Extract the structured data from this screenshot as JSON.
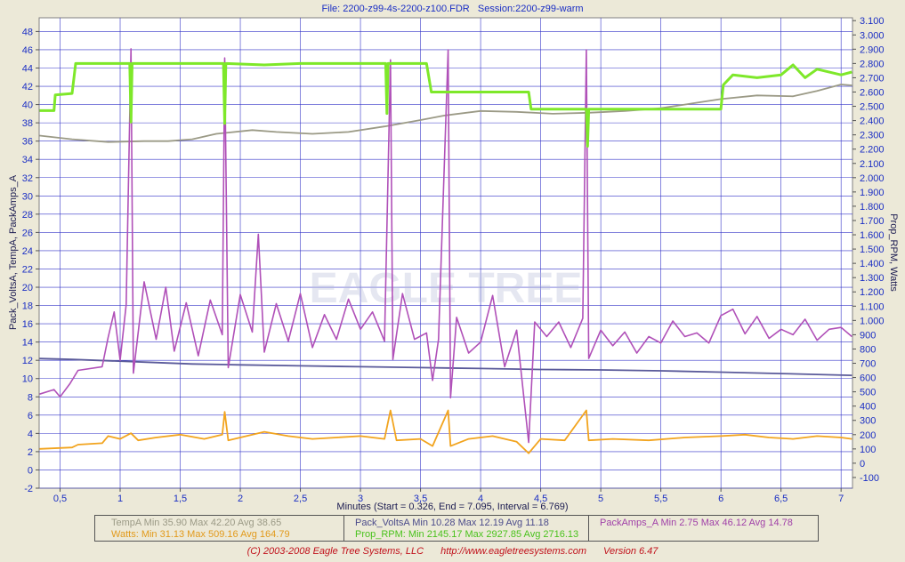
{
  "header": {
    "file": "File: 2200-z99-4s-2200-z100.FDR",
    "session": "Session:2200-z99-warm"
  },
  "chart_data": {
    "type": "line",
    "xlabel": "Minutes (Start = 0.326, End = 7.095, Interval = 6.769)",
    "ylabel_left": "Pack_VoltsA, TempA, PackAmps_A",
    "ylabel_right": "Prop_RPM, Watts",
    "xlim": [
      0.326,
      7.095
    ],
    "ylim_left": [
      -2,
      49.5
    ],
    "ylim_right": [
      -175,
      3120
    ],
    "x_ticks": [
      "0,5",
      "1",
      "1,5",
      "2",
      "2,5",
      "3",
      "3,5",
      "4",
      "4,5",
      "5",
      "5,5",
      "6",
      "6,5",
      "7"
    ],
    "y_ticks_left": [
      "-2",
      "0",
      "2",
      "4",
      "6",
      "8",
      "10",
      "12",
      "14",
      "16",
      "18",
      "20",
      "22",
      "24",
      "26",
      "28",
      "30",
      "32",
      "34",
      "36",
      "38",
      "40",
      "42",
      "44",
      "46",
      "48"
    ],
    "y_ticks_right": [
      "-100",
      "0",
      "100",
      "200",
      "300",
      "400",
      "500",
      "600",
      "700",
      "800",
      "900",
      "1.000",
      "1.100",
      "1.200",
      "1.300",
      "1.400",
      "1.500",
      "1.600",
      "1.700",
      "1.800",
      "1.900",
      "2.000",
      "2.100",
      "2.200",
      "2.300",
      "2.400",
      "2.500",
      "2.600",
      "2.700",
      "2.800",
      "2.900",
      "3.000",
      "3.100"
    ],
    "grid": true,
    "watermark": "EAGLE TREE",
    "series": [
      {
        "name": "TempA",
        "axis": "left",
        "color": "#9b9a86",
        "points": [
          [
            0.33,
            36.6
          ],
          [
            0.6,
            36.2
          ],
          [
            0.9,
            35.9
          ],
          [
            1.2,
            36.0
          ],
          [
            1.4,
            36.0
          ],
          [
            1.6,
            36.2
          ],
          [
            1.8,
            36.8
          ],
          [
            2.1,
            37.2
          ],
          [
            2.3,
            37.0
          ],
          [
            2.6,
            36.8
          ],
          [
            2.9,
            37.0
          ],
          [
            3.2,
            37.6
          ],
          [
            3.5,
            38.3
          ],
          [
            3.7,
            38.8
          ],
          [
            4.0,
            39.3
          ],
          [
            4.3,
            39.2
          ],
          [
            4.6,
            39.0
          ],
          [
            4.9,
            39.1
          ],
          [
            5.2,
            39.3
          ],
          [
            5.5,
            39.6
          ],
          [
            5.8,
            40.2
          ],
          [
            6.0,
            40.6
          ],
          [
            6.3,
            41.0
          ],
          [
            6.6,
            40.9
          ],
          [
            6.8,
            41.5
          ],
          [
            7.0,
            42.2
          ],
          [
            7.09,
            42.1
          ]
        ]
      },
      {
        "name": "Pack_VoltsA",
        "axis": "left",
        "color": "#5a5a9a",
        "points": [
          [
            0.33,
            12.19
          ],
          [
            0.6,
            12.1
          ],
          [
            0.9,
            11.95
          ],
          [
            1.2,
            11.8
          ],
          [
            1.6,
            11.6
          ],
          [
            2.0,
            11.5
          ],
          [
            2.5,
            11.4
          ],
          [
            3.0,
            11.3
          ],
          [
            3.5,
            11.2
          ],
          [
            4.0,
            11.1
          ],
          [
            4.5,
            11.0
          ],
          [
            5.0,
            10.95
          ],
          [
            5.5,
            10.85
          ],
          [
            6.0,
            10.7
          ],
          [
            6.5,
            10.55
          ],
          [
            7.09,
            10.35
          ]
        ]
      },
      {
        "name": "PackAmps_A",
        "axis": "left",
        "color": "#b050b8",
        "points": [
          [
            0.33,
            8.3
          ],
          [
            0.45,
            8.8
          ],
          [
            0.5,
            8.0
          ],
          [
            0.58,
            9.4
          ],
          [
            0.65,
            10.9
          ],
          [
            0.85,
            11.3
          ],
          [
            0.9,
            14.5
          ],
          [
            0.95,
            17.3
          ],
          [
            1.0,
            12.0
          ],
          [
            1.05,
            18.1
          ],
          [
            1.09,
            46.1
          ],
          [
            1.11,
            10.6
          ],
          [
            1.2,
            20.6
          ],
          [
            1.3,
            14.3
          ],
          [
            1.38,
            20.0
          ],
          [
            1.45,
            13.0
          ],
          [
            1.55,
            18.3
          ],
          [
            1.65,
            12.5
          ],
          [
            1.75,
            18.6
          ],
          [
            1.85,
            14.8
          ],
          [
            1.87,
            45.1
          ],
          [
            1.9,
            11.2
          ],
          [
            2.0,
            19.2
          ],
          [
            2.1,
            15.1
          ],
          [
            2.15,
            25.8
          ],
          [
            2.2,
            12.9
          ],
          [
            2.3,
            18.2
          ],
          [
            2.4,
            14.1
          ],
          [
            2.5,
            19.3
          ],
          [
            2.6,
            13.4
          ],
          [
            2.7,
            17.0
          ],
          [
            2.8,
            14.3
          ],
          [
            2.9,
            18.7
          ],
          [
            3.0,
            15.4
          ],
          [
            3.1,
            17.3
          ],
          [
            3.2,
            14.1
          ],
          [
            3.25,
            44.9
          ],
          [
            3.27,
            12.1
          ],
          [
            3.35,
            19.3
          ],
          [
            3.45,
            14.3
          ],
          [
            3.55,
            15.0
          ],
          [
            3.6,
            9.8
          ],
          [
            3.65,
            14.3
          ],
          [
            3.73,
            46.0
          ],
          [
            3.75,
            7.9
          ],
          [
            3.8,
            16.7
          ],
          [
            3.9,
            12.8
          ],
          [
            4.0,
            14.0
          ],
          [
            4.1,
            19.1
          ],
          [
            4.2,
            11.3
          ],
          [
            4.3,
            15.3
          ],
          [
            4.4,
            3.0
          ],
          [
            4.45,
            16.2
          ],
          [
            4.55,
            14.6
          ],
          [
            4.65,
            16.2
          ],
          [
            4.75,
            13.4
          ],
          [
            4.85,
            16.6
          ],
          [
            4.88,
            46.0
          ],
          [
            4.9,
            12.2
          ],
          [
            5.0,
            15.3
          ],
          [
            5.1,
            13.6
          ],
          [
            5.2,
            15.1
          ],
          [
            5.3,
            12.8
          ],
          [
            5.4,
            14.6
          ],
          [
            5.5,
            13.9
          ],
          [
            5.6,
            16.3
          ],
          [
            5.7,
            14.6
          ],
          [
            5.8,
            15.0
          ],
          [
            5.9,
            13.9
          ],
          [
            6.0,
            16.9
          ],
          [
            6.1,
            17.6
          ],
          [
            6.2,
            14.9
          ],
          [
            6.3,
            16.8
          ],
          [
            6.4,
            14.4
          ],
          [
            6.5,
            15.4
          ],
          [
            6.6,
            14.8
          ],
          [
            6.7,
            16.5
          ],
          [
            6.8,
            14.2
          ],
          [
            6.9,
            15.4
          ],
          [
            7.0,
            15.6
          ],
          [
            7.09,
            14.6
          ]
        ]
      },
      {
        "name": "Prop_RPM",
        "axis": "right",
        "color": "#7ee82a",
        "points": [
          [
            0.33,
            2470
          ],
          [
            0.45,
            2470
          ],
          [
            0.46,
            2580
          ],
          [
            0.6,
            2590
          ],
          [
            0.63,
            2800
          ],
          [
            1.08,
            2800
          ],
          [
            1.09,
            2390
          ],
          [
            1.1,
            2800
          ],
          [
            1.5,
            2800
          ],
          [
            1.86,
            2800
          ],
          [
            1.87,
            2380
          ],
          [
            1.88,
            2800
          ],
          [
            2.2,
            2790
          ],
          [
            2.5,
            2800
          ],
          [
            3.0,
            2800
          ],
          [
            3.21,
            2800
          ],
          [
            3.22,
            2450
          ],
          [
            3.23,
            2800
          ],
          [
            3.55,
            2800
          ],
          [
            3.59,
            2600
          ],
          [
            4.0,
            2600
          ],
          [
            4.4,
            2600
          ],
          [
            4.42,
            2480
          ],
          [
            4.88,
            2480
          ],
          [
            4.89,
            2220
          ],
          [
            4.9,
            2480
          ],
          [
            5.5,
            2480
          ],
          [
            6.0,
            2480
          ],
          [
            6.02,
            2650
          ],
          [
            6.1,
            2720
          ],
          [
            6.3,
            2700
          ],
          [
            6.5,
            2720
          ],
          [
            6.6,
            2790
          ],
          [
            6.7,
            2700
          ],
          [
            6.8,
            2760
          ],
          [
            7.0,
            2720
          ],
          [
            7.09,
            2740
          ]
        ]
      },
      {
        "name": "Watts",
        "axis": "right",
        "color": "#f2a41e",
        "points": [
          [
            0.33,
            100
          ],
          [
            0.6,
            110
          ],
          [
            0.65,
            130
          ],
          [
            0.85,
            140
          ],
          [
            0.9,
            190
          ],
          [
            1.0,
            170
          ],
          [
            1.09,
            210
          ],
          [
            1.15,
            160
          ],
          [
            1.3,
            180
          ],
          [
            1.5,
            200
          ],
          [
            1.7,
            170
          ],
          [
            1.85,
            200
          ],
          [
            1.87,
            360
          ],
          [
            1.9,
            160
          ],
          [
            2.0,
            180
          ],
          [
            2.2,
            220
          ],
          [
            2.4,
            190
          ],
          [
            2.6,
            170
          ],
          [
            2.8,
            180
          ],
          [
            3.0,
            190
          ],
          [
            3.2,
            170
          ],
          [
            3.25,
            370
          ],
          [
            3.3,
            160
          ],
          [
            3.5,
            170
          ],
          [
            3.6,
            120
          ],
          [
            3.73,
            370
          ],
          [
            3.75,
            120
          ],
          [
            3.9,
            170
          ],
          [
            4.1,
            190
          ],
          [
            4.3,
            150
          ],
          [
            4.4,
            70
          ],
          [
            4.5,
            170
          ],
          [
            4.7,
            160
          ],
          [
            4.88,
            370
          ],
          [
            4.9,
            160
          ],
          [
            5.1,
            170
          ],
          [
            5.4,
            160
          ],
          [
            5.7,
            180
          ],
          [
            6.0,
            190
          ],
          [
            6.2,
            200
          ],
          [
            6.4,
            180
          ],
          [
            6.6,
            170
          ],
          [
            6.8,
            190
          ],
          [
            7.0,
            180
          ],
          [
            7.09,
            170
          ]
        ]
      }
    ]
  },
  "legend": [
    {
      "line1": [
        {
          "text": "TempA   Min 35.90   Max 42.20   Avg 38.65",
          "color": "#9b9a86"
        }
      ],
      "line2": [
        {
          "text": "Watts:  Min 31.13   Max 509.16   Avg 164.79",
          "color": "#e29a1b"
        }
      ]
    },
    {
      "line1": [
        {
          "text": "Pack_VoltsA   Min 10.28   Max 12.19   Avg 11.18",
          "color": "#4a4a8a"
        }
      ],
      "line2": [
        {
          "text": "Prop_RPM:  Min 2145.17   Max 2927.85   Avg 2716.13",
          "color": "#49c21c"
        }
      ]
    },
    {
      "line1": [
        {
          "text": "PackAmps_A   Min 2.75   Max 46.12   Avg 14.78",
          "color": "#a040a8"
        }
      ],
      "line2": []
    }
  ],
  "footer": {
    "copyright": "(C) 2003-2008 Eagle Tree Systems, LLC",
    "url": "http://www.eagletreesystems.com",
    "version": "Version 6.47"
  }
}
